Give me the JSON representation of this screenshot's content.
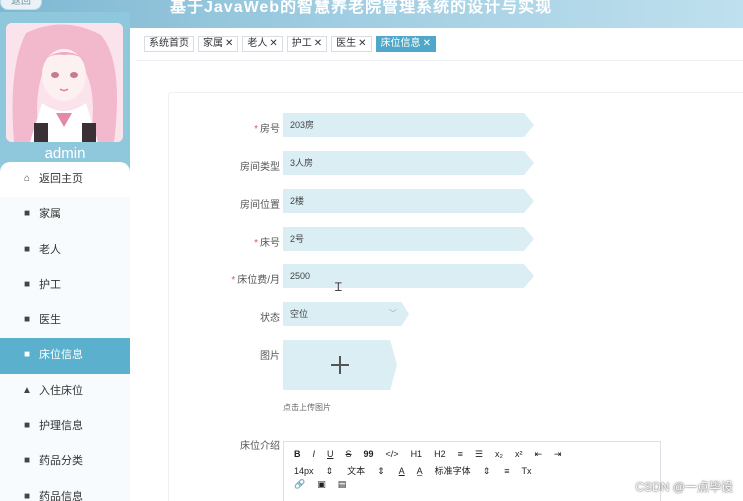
{
  "header": {
    "title": "基于JavaWeb的智慧养老院管理系统的设计与实现",
    "back_label": "返回"
  },
  "sidebar": {
    "username": "admin",
    "items": [
      {
        "label": "返回主页",
        "icon": "home-icon",
        "glyph": "⌂"
      },
      {
        "label": "家属",
        "icon": "grid-icon",
        "glyph": "■"
      },
      {
        "label": "老人",
        "icon": "briefcase-icon",
        "glyph": "■"
      },
      {
        "label": "护工",
        "icon": "document-icon",
        "glyph": "■"
      },
      {
        "label": "医生",
        "icon": "grid-icon",
        "glyph": "■"
      },
      {
        "label": "床位信息",
        "icon": "grid-icon",
        "glyph": "■"
      },
      {
        "label": "入住床位",
        "icon": "user-icon",
        "glyph": "▲"
      },
      {
        "label": "护理信息",
        "icon": "film-icon",
        "glyph": "■"
      },
      {
        "label": "药品分类",
        "icon": "chat-icon",
        "glyph": "■"
      },
      {
        "label": "药品信息",
        "icon": "document-icon",
        "glyph": "■"
      }
    ],
    "active_index": 5
  },
  "tags": [
    {
      "label": "系统首页",
      "closable": false,
      "active": false
    },
    {
      "label": "家属",
      "closable": true,
      "active": false
    },
    {
      "label": "老人",
      "closable": true,
      "active": false
    },
    {
      "label": "护工",
      "closable": true,
      "active": false
    },
    {
      "label": "医生",
      "closable": true,
      "active": false
    },
    {
      "label": "床位信息",
      "closable": true,
      "active": true
    }
  ],
  "form": {
    "room_no": {
      "label": "房号",
      "required": true,
      "value": "203房"
    },
    "room_type": {
      "label": "房间类型",
      "required": false,
      "value": "3人房"
    },
    "room_location": {
      "label": "房间位置",
      "required": false,
      "value": "2楼"
    },
    "bed_no": {
      "label": "床号",
      "required": true,
      "value": "2号"
    },
    "bed_fee": {
      "label": "床位费/月",
      "required": true,
      "value": "2500"
    },
    "status": {
      "label": "状态",
      "value": "空位"
    },
    "image": {
      "label": "图片",
      "hint": "点击上传图片"
    },
    "intro": {
      "label": "床位介绍"
    }
  },
  "editor_toolbar": {
    "row1": [
      "B",
      "I",
      "U",
      "S",
      "99",
      "</>",
      "H1",
      "H2",
      "≡",
      "☰",
      "x₂",
      "x²",
      "⇤",
      "⇥"
    ],
    "row2": [
      "14px",
      "⇕",
      "文本",
      "⇕",
      "A",
      "A̲",
      "标准字体",
      "⇕",
      "≡",
      "Tx"
    ],
    "row3": [
      "🔗",
      "▣",
      "▤"
    ]
  },
  "watermark": "CSDN @一点毕设",
  "colors": {
    "accent": "#5bb0cd",
    "field_bg": "#daeef4",
    "required": "#e05a5a",
    "header": "#8fc7dc"
  }
}
